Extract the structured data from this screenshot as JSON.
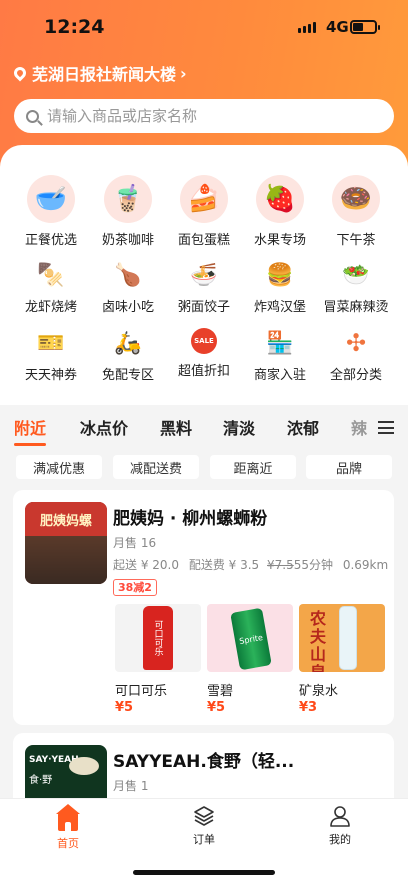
{
  "status": {
    "time": "12:24",
    "network": "4G"
  },
  "location": {
    "name": "芜湖日报社新闻大楼",
    "chevron": "›"
  },
  "search": {
    "placeholder": "请输入商品或店家名称"
  },
  "categories": [
    {
      "label": "正餐优选",
      "icon": "bowl-icon",
      "glyph": "🥣"
    },
    {
      "label": "奶茶咖啡",
      "icon": "milk-tea-icon",
      "glyph": "🧋"
    },
    {
      "label": "面包蛋糕",
      "icon": "cake-icon",
      "glyph": "🍰"
    },
    {
      "label": "水果专场",
      "icon": "strawberry-icon",
      "glyph": "🍓"
    },
    {
      "label": "下午茶",
      "icon": "donut-icon",
      "glyph": "🍩"
    },
    {
      "label": "龙虾烧烤",
      "icon": "skewer-icon",
      "glyph": "🍢"
    },
    {
      "label": "卤味小吃",
      "icon": "drumstick-icon",
      "glyph": "🍗"
    },
    {
      "label": "粥面饺子",
      "icon": "noodle-bowl-icon",
      "glyph": "🍜"
    },
    {
      "label": "炸鸡汉堡",
      "icon": "burger-icon",
      "glyph": "🍔"
    },
    {
      "label": "冒菜麻辣烫",
      "icon": "hotpot-bowl-icon",
      "glyph": "🥗"
    },
    {
      "label": "天天神券",
      "icon": "coupon-icon",
      "glyph": "🎫"
    },
    {
      "label": "免配专区",
      "icon": "courier-icon",
      "glyph": "🛵"
    },
    {
      "label": "超值折扣",
      "icon": "sale-badge-icon",
      "glyph": "SALE"
    },
    {
      "label": "商家入驻",
      "icon": "storefront-icon",
      "glyph": "🏪"
    },
    {
      "label": "全部分类",
      "icon": "all-categories-icon",
      "glyph": "✣"
    }
  ],
  "tabs": [
    "附近",
    "冰点价",
    "黑料",
    "清淡",
    "浓郁",
    "辣"
  ],
  "filters": [
    "满减优惠",
    "减配送费",
    "距离近",
    "品牌"
  ],
  "shops": [
    {
      "name": "肥姨妈 · 柳州螺蛳粉",
      "sales": "月售 16",
      "min_order": "起送 ¥ 20.0",
      "delivery_fee": "配送费 ¥ 3.5",
      "original_fee": "¥7.5",
      "time": "55分钟",
      "distance": "0.69km",
      "promo": "38减2",
      "sign_text": "肥姨妈螺",
      "products": [
        {
          "name": "可口可乐",
          "price": "¥5",
          "image_text": "可口可乐"
        },
        {
          "name": "雪碧",
          "price": "¥5",
          "image_text": "Sprite"
        },
        {
          "name": "矿泉水",
          "price": "¥3",
          "image_text": "农夫山泉"
        }
      ]
    },
    {
      "name": "SAYYEAH.食野（轻...",
      "sales": "月售 1",
      "image_text_top": "SAY·YEAH",
      "image_text_bottom": "食·野"
    }
  ],
  "bottom_nav": [
    {
      "label": "首页",
      "icon": "home-icon"
    },
    {
      "label": "订单",
      "icon": "orders-icon"
    },
    {
      "label": "我的",
      "icon": "profile-icon"
    }
  ],
  "colors": {
    "accent": "#ff5a1f",
    "hero_start": "#ff7a45",
    "hero_end": "#ff9b3b",
    "price": "#ff4a1a"
  }
}
